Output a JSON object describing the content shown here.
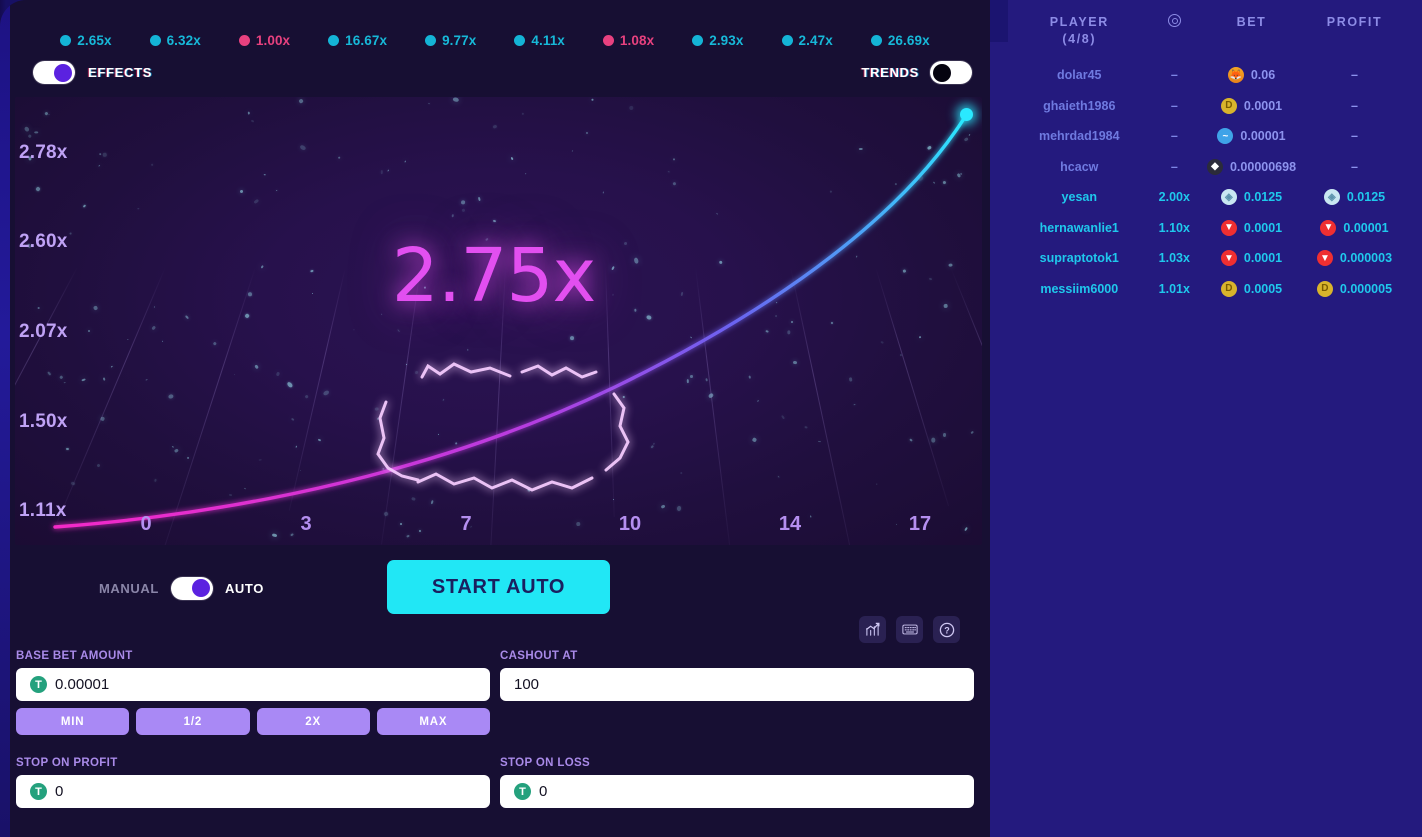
{
  "history": [
    {
      "value": "2.65x",
      "result": "win"
    },
    {
      "value": "6.32x",
      "result": "win"
    },
    {
      "value": "1.00x",
      "result": "loss"
    },
    {
      "value": "16.67x",
      "result": "win"
    },
    {
      "value": "9.77x",
      "result": "win"
    },
    {
      "value": "4.11x",
      "result": "win"
    },
    {
      "value": "1.08x",
      "result": "loss"
    },
    {
      "value": "2.93x",
      "result": "win"
    },
    {
      "value": "2.47x",
      "result": "win"
    },
    {
      "value": "26.69x",
      "result": "win"
    }
  ],
  "toggles": {
    "effects_label": "EFFECTS",
    "effects_state": "on",
    "trends_label": "TRENDS",
    "trends_state": "off"
  },
  "chart_data": {
    "type": "line",
    "title": "",
    "xlabel": "",
    "ylabel": "",
    "current_multiplier": "2.75x",
    "y_ticks": [
      "1.11x",
      "1.50x",
      "2.07x",
      "2.60x",
      "2.78x"
    ],
    "x_ticks": [
      "0",
      "3",
      "7",
      "10",
      "14",
      "17"
    ],
    "xlim": [
      -2,
      19
    ],
    "ylim": [
      1.0,
      2.85
    ],
    "x": [
      -2,
      0,
      3,
      7,
      10,
      14,
      17,
      18.6
    ],
    "y": [
      1.11,
      1.14,
      1.27,
      1.52,
      1.79,
      2.28,
      2.69,
      2.78
    ],
    "grid": false,
    "legend": "none",
    "line_gradient_from": "#f429c8",
    "line_gradient_to": "#2ae9ff"
  },
  "mode": {
    "manual_label": "MANUAL",
    "auto_label": "AUTO",
    "selected": "AUTO",
    "start_label": "START AUTO"
  },
  "icons": {
    "stats": "chart-icon",
    "keyboard": "keyboard-icon",
    "help": "help-icon"
  },
  "form": {
    "base_bet_label": "BASE BET AMOUNT",
    "base_bet_value": "0.00001",
    "base_bet_currency": "T",
    "cashout_label": "CASHOUT AT",
    "cashout_value": "100",
    "quick": [
      "MIN",
      "1/2",
      "2X",
      "MAX"
    ],
    "stop_profit_label": "STOP ON PROFIT",
    "stop_profit_value": "0",
    "stop_loss_label": "STOP ON LOSS",
    "stop_loss_value": "0"
  },
  "sidebar": {
    "headers": {
      "player": "PLAYER",
      "player_count": "(4/8)",
      "at": "@",
      "bet": "BET",
      "profit": "PROFIT"
    },
    "rows": [
      {
        "name": "dolar45",
        "at": "–",
        "bet": "0.06",
        "bet_coin": "shib",
        "profit": "–",
        "profit_coin": "",
        "cashed": false
      },
      {
        "name": "ghaieth1986",
        "at": "–",
        "bet": "0.0001",
        "bet_coin": "doge",
        "profit": "–",
        "profit_coin": "",
        "cashed": false
      },
      {
        "name": "mehrdad1984",
        "at": "–",
        "bet": "0.00001",
        "bet_coin": "bch",
        "profit": "–",
        "profit_coin": "",
        "cashed": false
      },
      {
        "name": "hcacw",
        "at": "–",
        "bet": "0.00000698",
        "bet_coin": "eth",
        "profit": "–",
        "profit_coin": "",
        "cashed": false
      },
      {
        "name": "yesan",
        "at": "2.00x",
        "bet": "0.0125",
        "bet_coin": "btc",
        "profit": "0.0125",
        "profit_coin": "btc",
        "cashed": true
      },
      {
        "name": "hernawanlie1",
        "at": "1.10x",
        "bet": "0.0001",
        "bet_coin": "trx",
        "profit": "0.00001",
        "profit_coin": "trx",
        "cashed": true
      },
      {
        "name": "supraptotok1",
        "at": "1.03x",
        "bet": "0.0001",
        "bet_coin": "trx",
        "profit": "0.000003",
        "profit_coin": "trx",
        "cashed": true
      },
      {
        "name": "messiim6000",
        "at": "1.01x",
        "bet": "0.0005",
        "bet_coin": "doge",
        "profit": "0.000005",
        "profit_coin": "doge",
        "cashed": true
      }
    ]
  }
}
